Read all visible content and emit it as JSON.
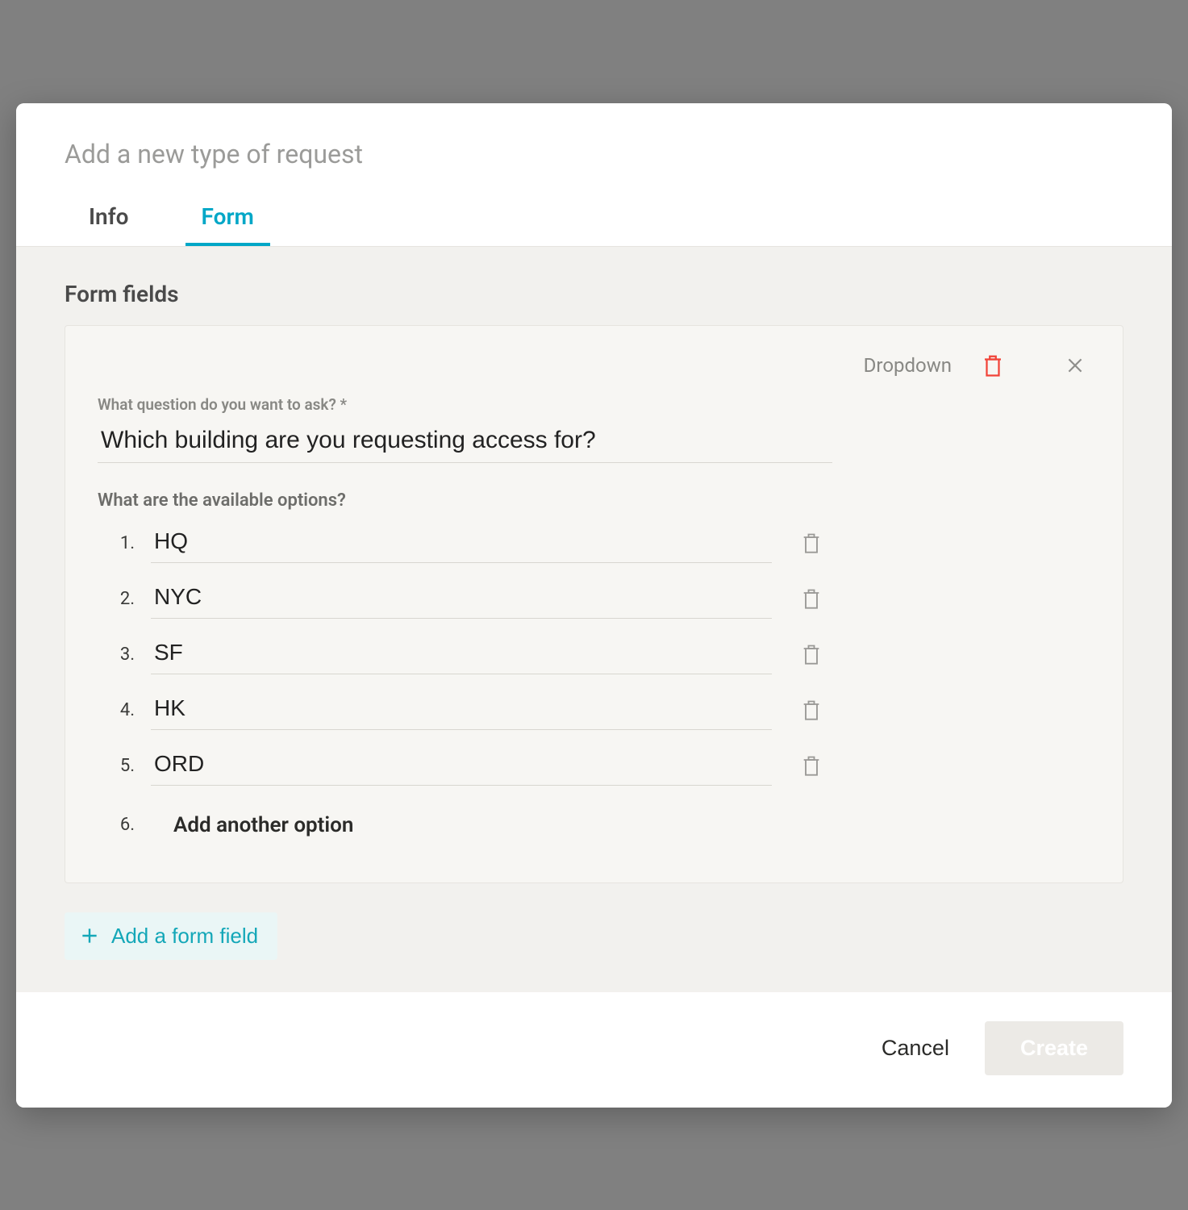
{
  "modal": {
    "title": "Add a new type of request",
    "tabs": [
      {
        "label": "Info",
        "active": false
      },
      {
        "label": "Form",
        "active": true
      }
    ]
  },
  "form": {
    "section_title": "Form fields",
    "field": {
      "type_label": "Dropdown",
      "question_label": "What question do you want to ask? *",
      "question_value": "Which building are you requesting access for?",
      "options_label": "What are the available options?",
      "options": [
        {
          "number": "1.",
          "value": "HQ"
        },
        {
          "number": "2.",
          "value": "NYC"
        },
        {
          "number": "3.",
          "value": "SF"
        },
        {
          "number": "4.",
          "value": "HK"
        },
        {
          "number": "5.",
          "value": "ORD"
        }
      ],
      "add_option_number": "6.",
      "add_option_label": "Add another option"
    },
    "add_field_label": "Add a form field"
  },
  "footer": {
    "cancel": "Cancel",
    "create": "Create"
  },
  "colors": {
    "accent": "#00a7c7",
    "danger": "#f14338"
  }
}
